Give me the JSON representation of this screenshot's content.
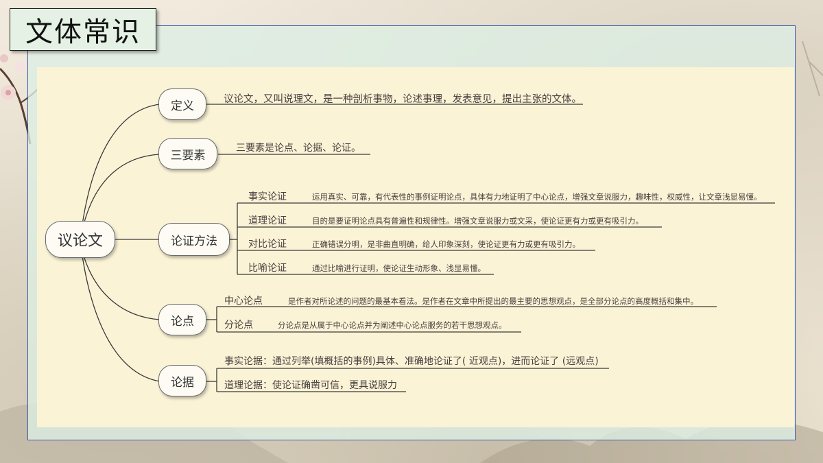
{
  "page_title": "文体常识",
  "mindmap": {
    "root": "议论文",
    "definition": {
      "label": "定义",
      "text": "议论文，又叫说理文，是一种剖析事物，论述事理，发表意见，提出主张的文体。"
    },
    "elements": {
      "label": "三要素",
      "text": "三要素是论点、论据、论证。"
    },
    "methods": {
      "label": "论证方法",
      "items": [
        {
          "name": "事实论证",
          "desc": "运用真实、可靠，有代表性的事例证明论点，具体有力地证明了中心论点，增强文章说服力，趣味性，权威性，让文章浅显易懂。"
        },
        {
          "name": "道理论证",
          "desc": "目的是要证明论点具有普遍性和规律性。增强文章说服力或文采，使论证更有力或更有吸引力。"
        },
        {
          "name": "对比论证",
          "desc": "正确错误分明，是非曲直明确，给人印象深刻，使论证更有力或更有吸引力。"
        },
        {
          "name": "比喻论证",
          "desc": "通过比喻进行证明，使论证生动形象、浅显易懂。"
        }
      ]
    },
    "thesis": {
      "label": "论点",
      "items": [
        {
          "name": "中心论点",
          "desc": "是作者对所论述的问题的最基本看法。是作者在文章中所提出的最主要的思想观点，是全部分论点的高度概括和集中。"
        },
        {
          "name": "分论点",
          "desc": "分论点是从属于中心论点并为阐述中心论点服务的若干思想观点。"
        }
      ]
    },
    "evidence": {
      "label": "论据",
      "items": [
        "事实论据：通过列举(填概括的事例)具体、准确地论证了( 近观点)，进而论证了 (远观点)",
        "道理论据：使论证确凿可信，更具说服力"
      ]
    }
  }
}
